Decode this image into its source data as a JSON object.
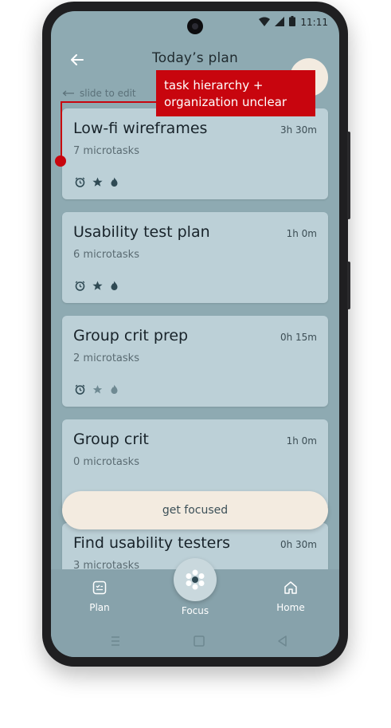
{
  "status_bar": {
    "time": "11:11"
  },
  "header": {
    "title": "Today’s plan"
  },
  "hint": {
    "text": "slide to edit"
  },
  "tasks": [
    {
      "title": "Low-fi wireframes",
      "duration": "3h 30m",
      "subtitle": "7 microtasks"
    },
    {
      "title": "Usability test plan",
      "duration": "1h 0m",
      "subtitle": "6 microtasks"
    },
    {
      "title": "Group crit prep",
      "duration": "0h 15m",
      "subtitle": "2 microtasks"
    },
    {
      "title": "Group crit",
      "duration": "1h 0m",
      "subtitle": "0 microtasks"
    },
    {
      "title": "Find usability testers",
      "duration": "0h 30m",
      "subtitle": "3 microtasks"
    }
  ],
  "focus_button": {
    "label": "get focused"
  },
  "nav": [
    {
      "label": "Plan",
      "icon": "plan-icon"
    },
    {
      "label": "Focus",
      "icon": "focus-icon"
    },
    {
      "label": "Home",
      "icon": "home-icon"
    }
  ],
  "annotation": {
    "text": "task hierarchy + organization unclear"
  },
  "colors": {
    "screen_bg": "#8eaab2",
    "card_bg": "#bcd0d7",
    "cream": "#f3ebe0",
    "annotation_red": "#c8050e"
  }
}
